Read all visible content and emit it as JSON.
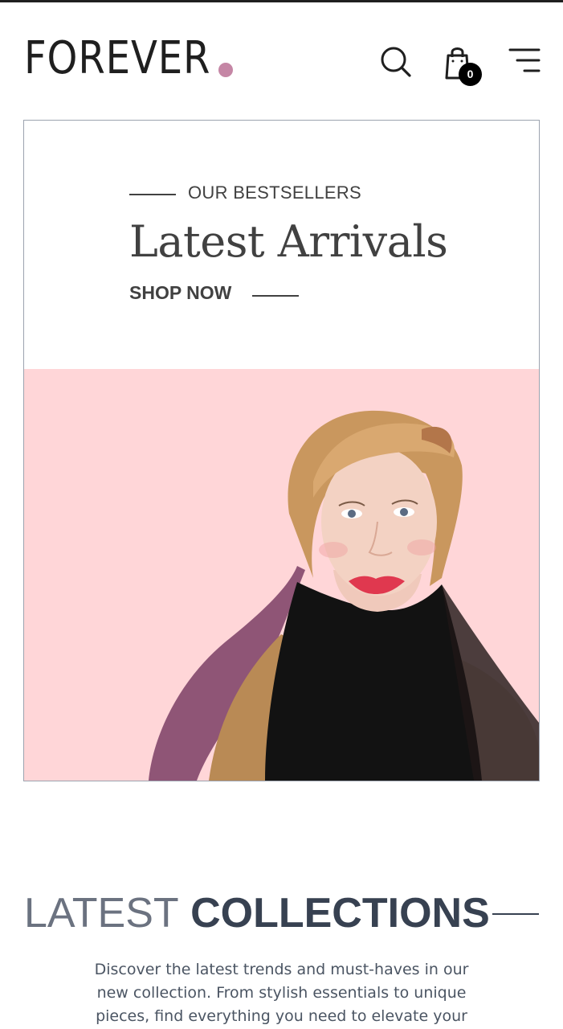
{
  "header": {
    "logo_text": "FOREVER",
    "cart_count": "0",
    "icons": {
      "search": "search-icon",
      "cart": "shopping-bag-icon",
      "menu": "menu-icon"
    }
  },
  "hero": {
    "eyebrow": "OUR BESTSELLERS",
    "title": "Latest Arrivals",
    "cta": "SHOP NOW",
    "image_alt": "Model with blonde hair wearing black sheer scarf on pink background"
  },
  "collections": {
    "title_light": "LATEST",
    "title_bold": "COLLECTIONS",
    "description": "Discover the latest trends and must-haves in our new collection. From stylish essentials to unique pieces, find everything you need to elevate your"
  },
  "colors": {
    "accent_dot": "#C586A5",
    "hero_bg": "#FFD6D8",
    "text_dark": "#414141"
  }
}
